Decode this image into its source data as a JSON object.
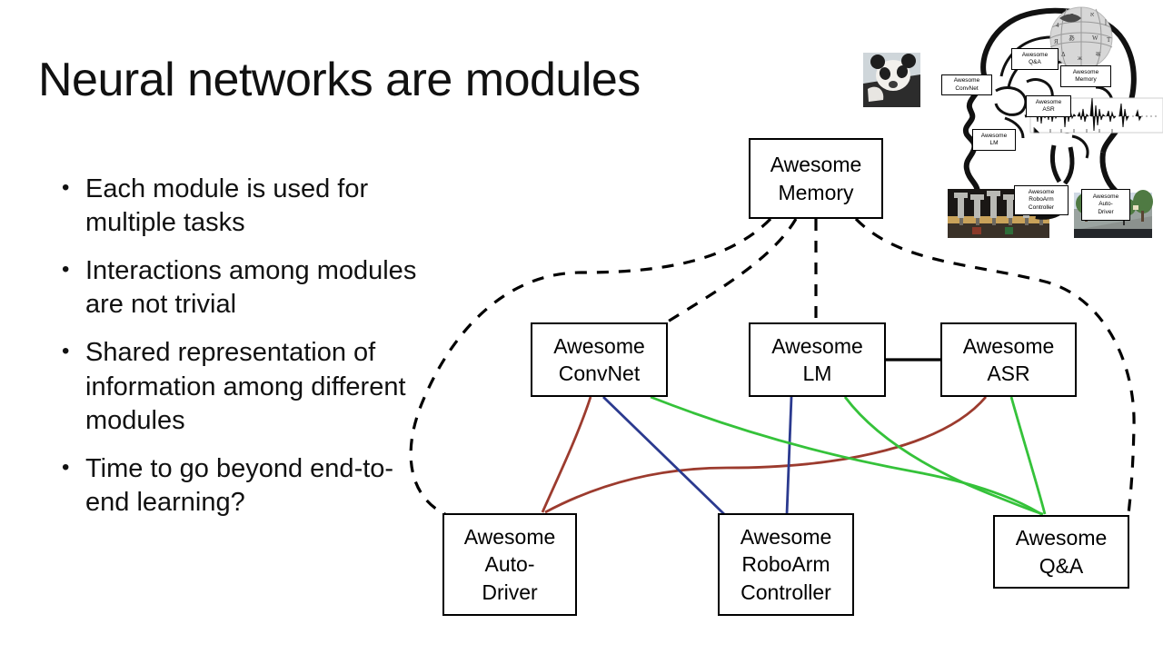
{
  "slide": {
    "title": "Neural networks are modules",
    "bullet_marker": "•",
    "bullets": [
      "Each module is used for multiple tasks",
      "Interactions among modules are not trivial",
      "Shared representation of information among different modules",
      "Time to go beyond end-to-end learning?"
    ]
  },
  "diagram": {
    "nodes": [
      {
        "id": "memory",
        "line1": "Awesome",
        "line2": "Memory",
        "line3": ""
      },
      {
        "id": "convnet",
        "line1": "Awesome",
        "line2": "ConvNet",
        "line3": ""
      },
      {
        "id": "lm",
        "line1": "Awesome",
        "line2": "LM",
        "line3": ""
      },
      {
        "id": "asr",
        "line1": "Awesome",
        "line2": "ASR",
        "line3": ""
      },
      {
        "id": "autodriver",
        "line1": "Awesome",
        "line2": "Auto-",
        "line3": "Driver"
      },
      {
        "id": "roboarm",
        "line1": "Awesome",
        "line2": "RoboArm",
        "line3": "Controller"
      },
      {
        "id": "qa",
        "line1": "Awesome",
        "line2": "Q&A",
        "line3": ""
      }
    ],
    "colors": {
      "node_border": "#000000",
      "dashed_edge": "#000000",
      "solid_edge": "#000000",
      "red_edge": "#9c3b2e",
      "blue_edge": "#2b3a8f",
      "green_edge": "#35c23a"
    }
  },
  "brain_figure": {
    "labels": [
      {
        "id": "brain-convnet",
        "line1": "Awesome",
        "line2": "ConvNet",
        "line3": ""
      },
      {
        "id": "brain-qa",
        "line1": "Awesome",
        "line2": "Q&A",
        "line3": ""
      },
      {
        "id": "brain-memory",
        "line1": "Awesome",
        "line2": "Memory",
        "line3": ""
      },
      {
        "id": "brain-asr",
        "line1": "Awesome",
        "line2": "ASR",
        "line3": ""
      },
      {
        "id": "brain-lm",
        "line1": "Awesome",
        "line2": "LM",
        "line3": ""
      },
      {
        "id": "brain-roboarm",
        "line1": "Awesome",
        "line2": "RoboArm",
        "line3": "Controller"
      },
      {
        "id": "brain-auto",
        "line1": "Awesome",
        "line2": "Auto-",
        "line3": "Driver"
      }
    ]
  }
}
